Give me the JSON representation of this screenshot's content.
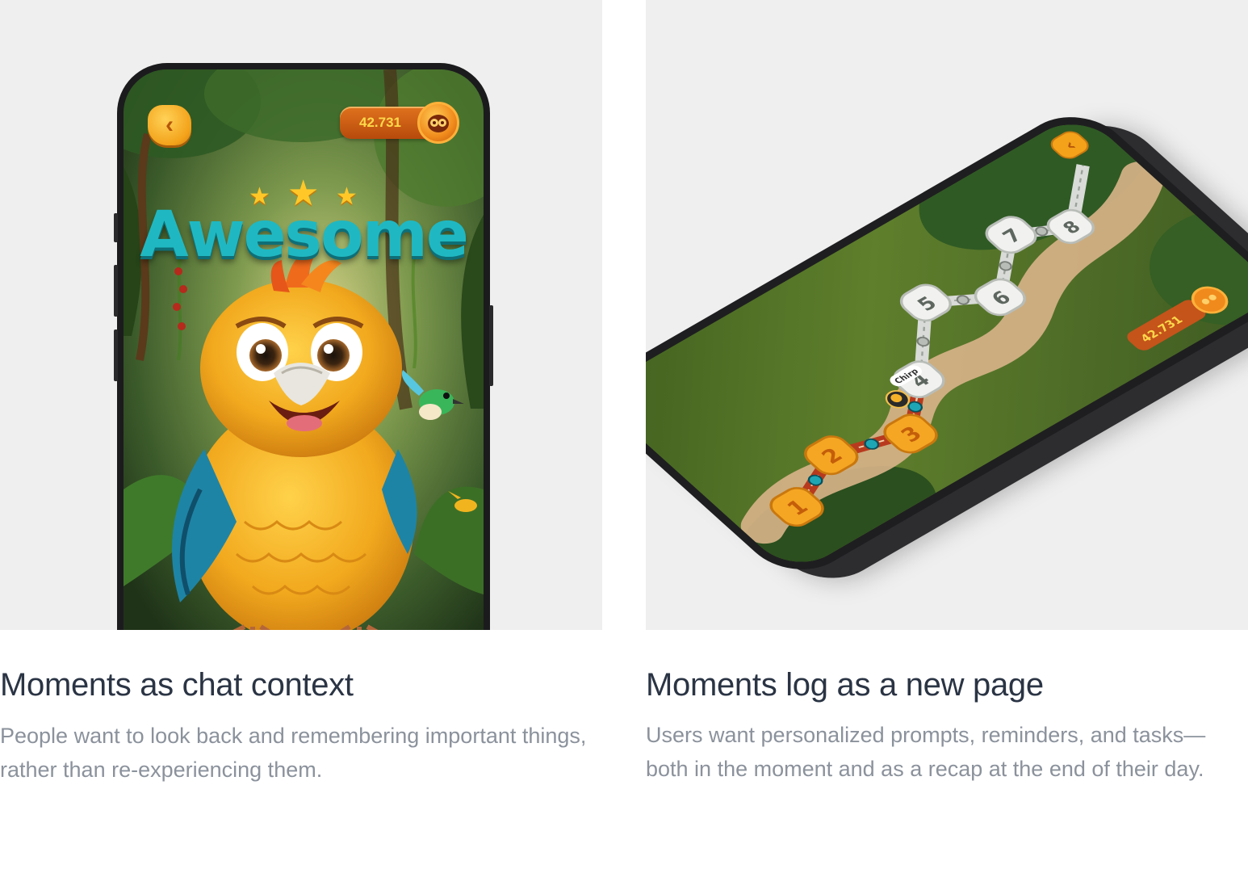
{
  "left_card": {
    "title": "Moments as chat context",
    "description": "People want to look back and remembering important things, rather than re-experiencing them.",
    "phone": {
      "screen": "awesome-celebration",
      "coin_balance": "42.731",
      "headline": "Awesome",
      "stars": 3,
      "back_icon": "chevron-left-icon",
      "coin_icon": "mascot-coin-icon"
    }
  },
  "right_card": {
    "title": "Moments log as a new page",
    "description": "Users want personalized prompts, reminders, and tasks—both in the moment and as a recap at the end of their day.",
    "phone": {
      "screen": "level-map",
      "coin_balance": "42.731",
      "player_label": "Chirp",
      "levels": [
        "1",
        "2",
        "3",
        "4",
        "5",
        "6",
        "7",
        "8"
      ],
      "completed_levels": [
        "1",
        "2",
        "3"
      ],
      "back_icon": "chevron-left-icon",
      "coin_icon": "mascot-coin-icon"
    }
  },
  "colors": {
    "panel_bg": "#efefef",
    "title_text": "#2a3444",
    "body_text": "#8b929c",
    "accent_orange": "#f3a21a",
    "headline_teal": "#1fb8c2"
  }
}
